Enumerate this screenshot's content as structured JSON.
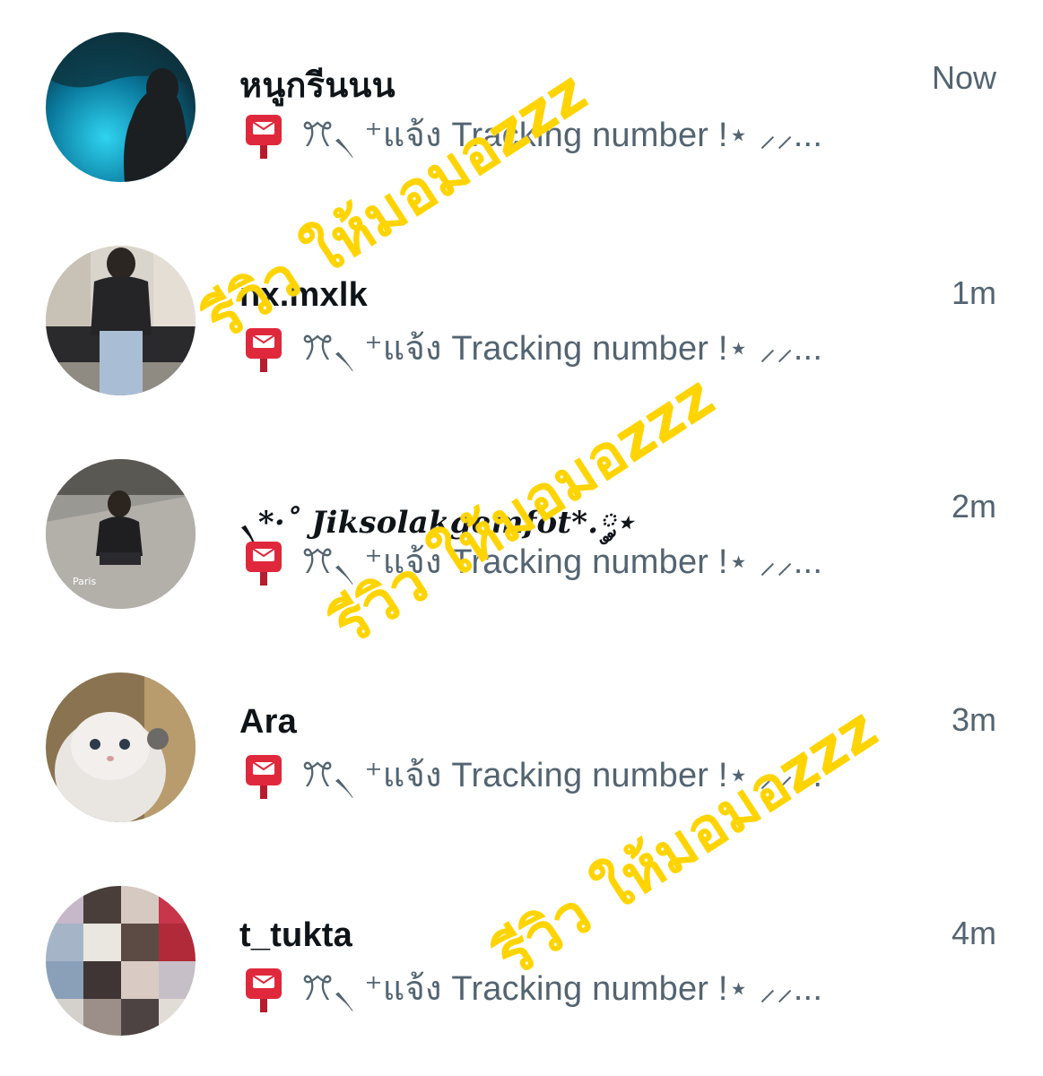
{
  "rows": [
    {
      "name": "หนูกรีนนน",
      "time": "Now",
      "preview": "ꔫ৲ ⁺แจ้ง Tracking number !⋆ ⸝⸝...",
      "avatar_icon": "user-avatar"
    },
    {
      "name": "nx.mxlk",
      "time": "1m",
      "preview": "ꔫ৲ ⁺แจ้ง Tracking number !⋆ ⸝⸝...",
      "avatar_icon": "user-avatar"
    },
    {
      "name": "৲*·˚ Jiksolakgemfot*.༘⋆",
      "time": "2m",
      "preview": "ꔫ৲ ⁺แจ้ง Tracking number !⋆ ⸝⸝...",
      "avatar_icon": "user-avatar"
    },
    {
      "name": "Ara",
      "time": "3m",
      "preview": "ꔫ৲ ⁺แจ้ง Tracking number !⋆ ⸝⸝...",
      "avatar_icon": "user-avatar"
    },
    {
      "name": "t_tukta",
      "time": "4m",
      "preview": "ꔫ৲ ⁺แจ้ง Tracking number !⋆ ⸝⸝...",
      "avatar_icon": "user-avatar"
    }
  ],
  "preview_icon": "postbox-icon",
  "watermark": "รีวิว ให้มอมอzzz",
  "colors": {
    "name": "#0f1419",
    "secondary": "#536471",
    "watermark": "#ffd400",
    "postbox": "#e0283c"
  }
}
